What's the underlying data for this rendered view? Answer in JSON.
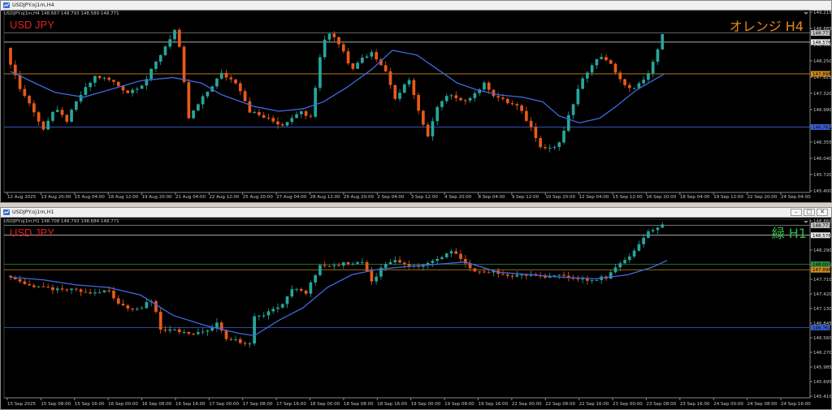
{
  "colors": {
    "bull": "#26a69a",
    "bear": "#e8591a",
    "ma": "#4169e1",
    "line_white": "#bdbdbd",
    "line_orange": "#d08a1c",
    "line_green": "#2e8b3d",
    "line_blue": "#2d4fd0",
    "symbol": "#e02020",
    "tf_orange": "#e8891c",
    "tf_green": "#2fb84a"
  },
  "windows": [
    {
      "title": "USDJPY.oj1m,H4",
      "info": "USDJPY.oj1m,H4  148.667 148.793 148.589 148.771",
      "symbol": "USD JPY",
      "timeframe_label": "オレンジ H4",
      "price_ticks": [
        "149.215",
        "148.885",
        "148.580",
        "148.250",
        "147.625",
        "147.320",
        "146.990",
        "146.675",
        "146.355",
        "146.040",
        "145.720",
        "145.400"
      ],
      "time_labels": [
        "12 Aug 2025",
        "13 Aug 20:00",
        "15 Aug 04:00",
        "18 Aug 12:00",
        "19 Aug 20:00",
        "21 Aug 04:00",
        "22 Aug 12:00",
        "25 Aug 20:00",
        "27 Aug 04:00",
        "28 Aug 12:00",
        "29 Aug 20:00",
        "2 Sep 04:00",
        "3 Sep 12:00",
        "4 Sep 20:00",
        "8 Sep 04:00",
        "9 Sep 12:00",
        "10 Sep 20:00",
        "12 Sep 04:00",
        "15 Sep 12:00",
        "16 Sep 20:00",
        "18 Sep 04:00",
        "19 Sep 12:00",
        "22 Sep 20:00",
        "24 Sep 04:00"
      ],
      "price_boxes": [
        {
          "text": "148.771",
          "color": "#c0c0c0"
        },
        {
          "text": "148.576",
          "color": "#e6e6e6"
        },
        {
          "text": "147.898",
          "color": "#d08a1c"
        },
        {
          "text": "146.762",
          "color": "#3a5fd0"
        }
      ]
    },
    {
      "title": "USDJPY.oj1m,H1",
      "info": "USDJPY.oj1m,H1  148.708 148.793 148.684 148.771",
      "symbol": "USD JPY",
      "timeframe_label": "緑 H1",
      "price_ticks": [
        "148.860",
        "148.575",
        "148.290",
        "148.005",
        "147.710",
        "147.420",
        "147.130",
        "146.845",
        "146.560",
        "146.270",
        "145.985",
        "145.695",
        "145.410"
      ],
      "time_labels": [
        "15 Sep 2025",
        "15 Sep 08:00",
        "15 Sep 16:00",
        "16 Sep 00:00",
        "16 Sep 08:00",
        "16 Sep 16:00",
        "17 Sep 00:00",
        "17 Sep 08:00",
        "17 Sep 16:00",
        "18 Sep 00:00",
        "18 Sep 08:00",
        "18 Sep 16:00",
        "19 Sep 00:00",
        "19 Sep 08:00",
        "19 Sep 16:00",
        "22 Sep 00:00",
        "22 Sep 08:00",
        "22 Sep 16:00",
        "23 Sep 00:00",
        "23 Sep 08:00",
        "23 Sep 16:00",
        "24 Sep 00:00",
        "24 Sep 08:00",
        "24 Sep 16:00"
      ],
      "price_boxes": [
        {
          "text": "148.771",
          "color": "#c0c0c0"
        },
        {
          "text": "148.576",
          "color": "#e6e6e6"
        },
        {
          "text": "148.007",
          "color": "#2e8b3d"
        },
        {
          "text": "147.898",
          "color": "#d08a1c"
        },
        {
          "text": "146.762",
          "color": "#3a5fd0"
        }
      ]
    }
  ],
  "chart_data": [
    {
      "type": "candlestick",
      "symbol": "USDJPY.oj1m",
      "timeframe": "H4",
      "ylim": [
        145.4,
        149.215
      ],
      "x_range": [
        "12 Aug 2025",
        "24 Sep 04:00"
      ],
      "horizontal_lines": [
        {
          "price": 148.771,
          "color": "#808080"
        },
        {
          "price": 148.576,
          "color": "#e6e6e6"
        },
        {
          "price": 147.898,
          "color": "#d08a1c"
        },
        {
          "price": 146.762,
          "color": "#3a5fd0"
        }
      ],
      "moving_average_path": [
        [
          0,
          147.95
        ],
        [
          30,
          147.7
        ],
        [
          55,
          147.5
        ],
        [
          90,
          147.4
        ],
        [
          130,
          147.6
        ],
        [
          160,
          147.75
        ],
        [
          200,
          147.82
        ],
        [
          235,
          147.7
        ],
        [
          260,
          147.45
        ],
        [
          300,
          147.2
        ],
        [
          330,
          147.1
        ],
        [
          360,
          147.15
        ],
        [
          385,
          147.3
        ],
        [
          415,
          147.62
        ],
        [
          445,
          148.0
        ],
        [
          470,
          148.4
        ],
        [
          500,
          148.3
        ],
        [
          525,
          148.0
        ],
        [
          550,
          147.7
        ],
        [
          575,
          147.55
        ],
        [
          600,
          147.45
        ],
        [
          630,
          147.4
        ],
        [
          655,
          147.3
        ],
        [
          675,
          147.0
        ],
        [
          700,
          146.85
        ],
        [
          725,
          146.95
        ],
        [
          745,
          147.2
        ],
        [
          770,
          147.55
        ],
        [
          790,
          147.75
        ],
        [
          805,
          147.9
        ]
      ],
      "price_path": [
        [
          0,
          148.45
        ],
        [
          10,
          147.9
        ],
        [
          20,
          147.5
        ],
        [
          30,
          147.25
        ],
        [
          45,
          146.7
        ],
        [
          60,
          147.15
        ],
        [
          75,
          146.9
        ],
        [
          90,
          147.4
        ],
        [
          110,
          147.85
        ],
        [
          130,
          147.75
        ],
        [
          150,
          147.5
        ],
        [
          170,
          147.7
        ],
        [
          190,
          148.3
        ],
        [
          210,
          148.9
        ],
        [
          225,
          146.95
        ],
        [
          245,
          147.45
        ],
        [
          265,
          147.9
        ],
        [
          285,
          147.7
        ],
        [
          300,
          147.1
        ],
        [
          320,
          146.95
        ],
        [
          340,
          146.8
        ],
        [
          360,
          147.1
        ],
        [
          375,
          147.0
        ],
        [
          390,
          148.6
        ],
        [
          400,
          148.8
        ],
        [
          415,
          148.4
        ],
        [
          425,
          148.0
        ],
        [
          435,
          148.2
        ],
        [
          450,
          148.35
        ],
        [
          465,
          148.05
        ],
        [
          480,
          147.35
        ],
        [
          495,
          147.85
        ],
        [
          510,
          147.0
        ],
        [
          520,
          146.5
        ],
        [
          530,
          147.2
        ],
        [
          545,
          147.45
        ],
        [
          560,
          147.3
        ],
        [
          575,
          147.45
        ],
        [
          590,
          147.7
        ],
        [
          600,
          147.45
        ],
        [
          615,
          147.3
        ],
        [
          630,
          147.2
        ],
        [
          645,
          146.8
        ],
        [
          660,
          146.3
        ],
        [
          680,
          146.35
        ],
        [
          690,
          146.85
        ],
        [
          705,
          147.6
        ],
        [
          720,
          148.1
        ],
        [
          735,
          148.3
        ],
        [
          750,
          147.95
        ],
        [
          765,
          147.55
        ],
        [
          785,
          147.75
        ],
        [
          800,
          148.25
        ],
        [
          808,
          148.77
        ]
      ]
    },
    {
      "type": "candlestick",
      "symbol": "USDJPY.oj1m",
      "timeframe": "H1",
      "ylim": [
        145.41,
        148.86
      ],
      "x_range": [
        "15 Sep 2025",
        "24 Sep 16:00"
      ],
      "horizontal_lines": [
        {
          "price": 148.771,
          "color": "#808080"
        },
        {
          "price": 148.576,
          "color": "#e6e6e6"
        },
        {
          "price": 148.007,
          "color": "#2e8b3d"
        },
        {
          "price": 147.898,
          "color": "#d08a1c"
        },
        {
          "price": 146.762,
          "color": "#3a5fd0"
        }
      ],
      "moving_average_path": [
        [
          0,
          147.75
        ],
        [
          40,
          147.7
        ],
        [
          80,
          147.6
        ],
        [
          120,
          147.55
        ],
        [
          160,
          147.4
        ],
        [
          200,
          147.0
        ],
        [
          240,
          146.8
        ],
        [
          280,
          146.65
        ],
        [
          300,
          146.6
        ],
        [
          330,
          146.9
        ],
        [
          360,
          147.15
        ],
        [
          390,
          147.55
        ],
        [
          420,
          147.8
        ],
        [
          450,
          147.9
        ],
        [
          480,
          147.95
        ],
        [
          520,
          148.0
        ],
        [
          560,
          148.05
        ],
        [
          600,
          147.85
        ],
        [
          640,
          147.8
        ],
        [
          680,
          147.75
        ],
        [
          720,
          147.72
        ],
        [
          760,
          147.8
        ],
        [
          790,
          147.95
        ],
        [
          808,
          148.08
        ]
      ],
      "price_path": [
        [
          0,
          147.78
        ],
        [
          20,
          147.65
        ],
        [
          40,
          147.55
        ],
        [
          60,
          147.5
        ],
        [
          80,
          147.5
        ],
        [
          100,
          147.45
        ],
        [
          125,
          147.5
        ],
        [
          140,
          147.2
        ],
        [
          160,
          147.1
        ],
        [
          180,
          147.3
        ],
        [
          190,
          146.75
        ],
        [
          205,
          146.7
        ],
        [
          225,
          146.65
        ],
        [
          245,
          146.7
        ],
        [
          260,
          146.85
        ],
        [
          270,
          146.55
        ],
        [
          285,
          146.5
        ],
        [
          300,
          146.4
        ],
        [
          305,
          146.95
        ],
        [
          320,
          147.05
        ],
        [
          340,
          147.2
        ],
        [
          355,
          147.55
        ],
        [
          370,
          147.45
        ],
        [
          385,
          147.95
        ],
        [
          400,
          148.0
        ],
        [
          420,
          148.02
        ],
        [
          440,
          148.05
        ],
        [
          450,
          147.65
        ],
        [
          465,
          148.0
        ],
        [
          480,
          148.1
        ],
        [
          500,
          147.95
        ],
        [
          520,
          148.0
        ],
        [
          535,
          148.15
        ],
        [
          550,
          148.25
        ],
        [
          565,
          148.0
        ],
        [
          580,
          147.85
        ],
        [
          600,
          147.85
        ],
        [
          620,
          147.78
        ],
        [
          640,
          147.8
        ],
        [
          660,
          147.75
        ],
        [
          680,
          147.8
        ],
        [
          700,
          147.75
        ],
        [
          720,
          147.7
        ],
        [
          740,
          147.75
        ],
        [
          755,
          148.0
        ],
        [
          770,
          148.15
        ],
        [
          785,
          148.55
        ],
        [
          795,
          148.7
        ],
        [
          808,
          148.77
        ]
      ]
    }
  ]
}
